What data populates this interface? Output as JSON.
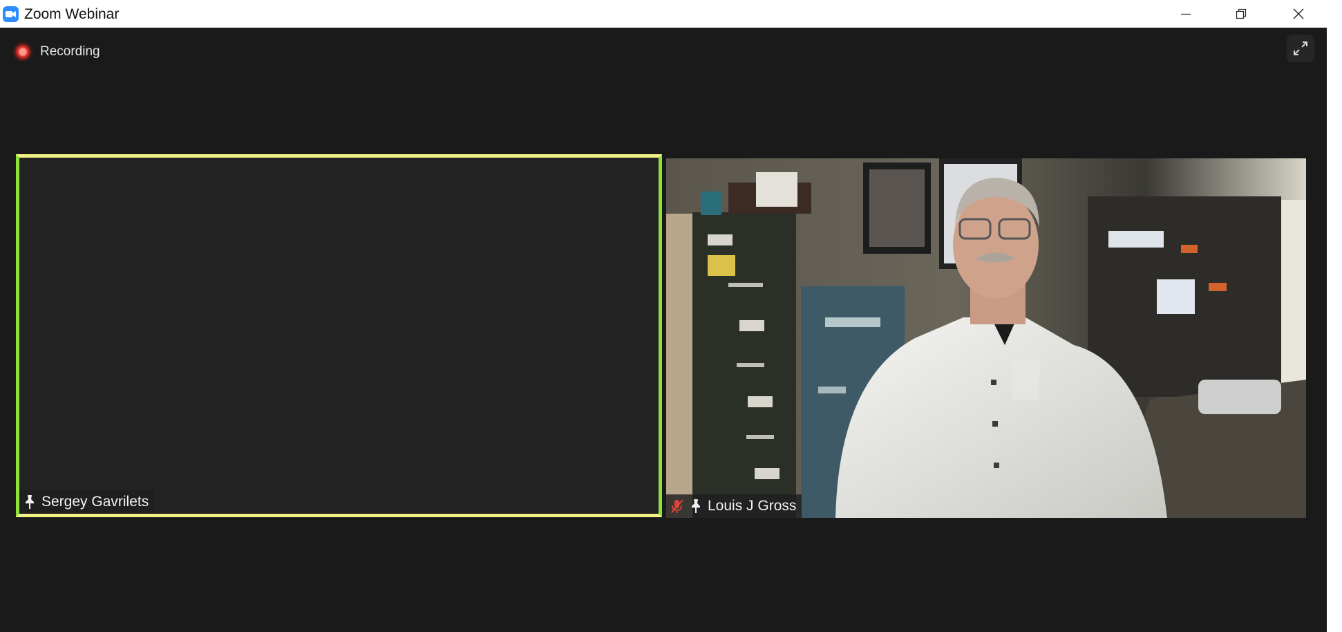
{
  "window": {
    "title": "Zoom Webinar",
    "controls": [
      "minimize-icon",
      "restore-icon",
      "close-icon"
    ]
  },
  "meeting": {
    "recording_label": "Recording",
    "fullscreen_icon": "expand-icon"
  },
  "participants": [
    {
      "name": "Sergey Gavrilets",
      "pinned": true,
      "muted": false,
      "video": false,
      "active_speaker": true
    },
    {
      "name": "Louis J Gross",
      "pinned": true,
      "muted": true,
      "video": true,
      "active_speaker": false
    }
  ],
  "colors": {
    "stage_bg": "#1a1a1a",
    "active_border": "#f1f184",
    "active_border_side": "#8fe23a",
    "recording_red": "#e2332a",
    "zoom_blue": "#2d8cff",
    "muted_red": "#e0433a"
  }
}
